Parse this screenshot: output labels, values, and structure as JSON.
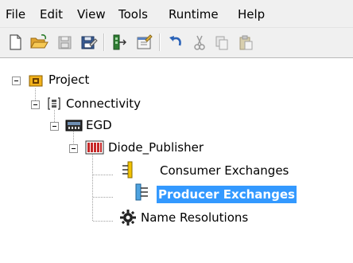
{
  "menu": {
    "file": "File",
    "edit": "Edit",
    "view": "View",
    "tools": "Tools",
    "runtime": "Runtime",
    "help": "Help"
  },
  "toolbar": {
    "icons": [
      "new-document-icon",
      "open-folder-icon",
      "save-icon",
      "save-all-icon",
      "add-device-icon",
      "properties-icon",
      "undo-icon",
      "cut-icon",
      "copy-icon",
      "paste-icon"
    ]
  },
  "tree": {
    "project": "Project",
    "connectivity": "Connectivity",
    "egd": "EGD",
    "diode_publisher": "Diode_Publisher",
    "consumer_exchanges": "Consumer Exchanges",
    "producer_exchanges": "Producer Exchanges",
    "name_resolutions": "Name Resolutions"
  },
  "colors": {
    "selection": "#3399ff",
    "project_icon": "#f2b21b",
    "exchange_icon": "#4fa3e0"
  }
}
